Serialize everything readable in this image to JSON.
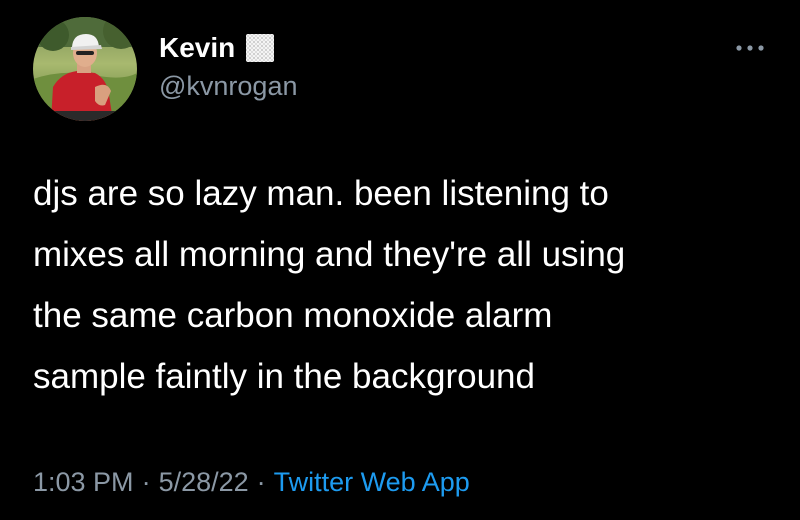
{
  "author": {
    "display_name": "Kevin",
    "handle": "@kvnrogan",
    "avatar_icon": "profile-photo-icon",
    "flag_icon": "flag-emoji-icon"
  },
  "menu": {
    "more_icon": "more-horizontal-icon"
  },
  "tweet": {
    "text": "djs are so lazy man. been listening to\nmixes all morning and they're all using\nthe same carbon monoxide alarm\nsample faintly in the background"
  },
  "meta": {
    "time": "1:03 PM",
    "date": "5/28/22",
    "separator": "·",
    "source": "Twitter Web App"
  },
  "colors": {
    "background": "#000000",
    "primary_text": "#ffffff",
    "secondary_text": "#8b98a5",
    "link": "#1d9bf0"
  }
}
